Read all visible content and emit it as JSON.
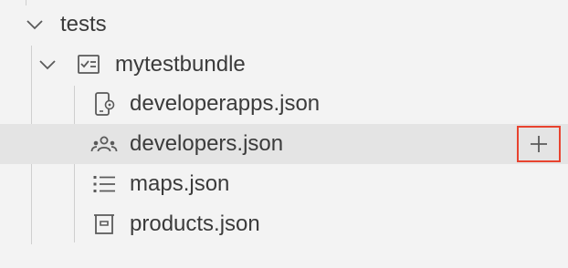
{
  "tree": {
    "folder": {
      "label": "tests",
      "icon": "chevron-down-icon"
    },
    "bundle": {
      "label": "mytestbundle",
      "icon": "test-bundle-icon",
      "chevron": "chevron-down-icon"
    },
    "files": [
      {
        "label": "developerapps.json",
        "icon": "device-gear-icon"
      },
      {
        "label": "developers.json",
        "icon": "people-icon",
        "selected": true
      },
      {
        "label": "maps.json",
        "icon": "list-icon"
      },
      {
        "label": "products.json",
        "icon": "archive-box-icon"
      }
    ]
  },
  "actions": {
    "add_icon": "plus-icon",
    "highlight_color": "#e8432f"
  },
  "colors": {
    "background": "#f3f3f3",
    "selected_row": "#e4e4e4",
    "text": "#3b3b3b",
    "icon": "#5a5a5a"
  }
}
